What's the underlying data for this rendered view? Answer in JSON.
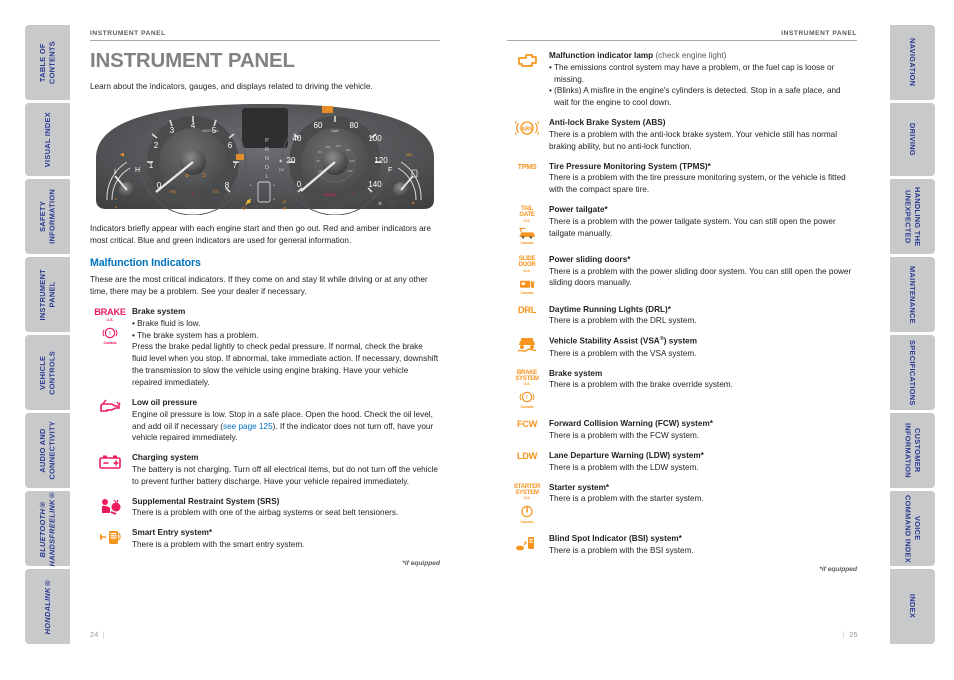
{
  "colors": {
    "red": "#ed1a5b",
    "amber": "#f7941e",
    "blue_heading": "#0071bc",
    "tab_bg": "#c8c9cb",
    "tab_text": "#2b3990",
    "title_gray": "#808285"
  },
  "left_tabs": [
    {
      "label": "TABLE OF\nCONTENTS",
      "italic": false
    },
    {
      "label": "VISUAL INDEX",
      "italic": false
    },
    {
      "label": "SAFETY\nINFORMATION",
      "italic": false
    },
    {
      "label": "INSTRUMENT\nPANEL",
      "italic": false
    },
    {
      "label": "VEHICLE\nCONTROLS",
      "italic": false
    },
    {
      "label": "AUDIO AND\nCONNECTIVITY",
      "italic": false
    },
    {
      "label": "BLUETOOTH®\nHANDSFREELINK®",
      "italic": true
    },
    {
      "label": "HONDALINK®",
      "italic": true
    }
  ],
  "right_tabs": [
    {
      "label": "NAVIGATION"
    },
    {
      "label": "DRIVING"
    },
    {
      "label": "HANDLING THE\nUNEXPECTED"
    },
    {
      "label": "MAINTENANCE"
    },
    {
      "label": "SPECIFICATIONS"
    },
    {
      "label": "CUSTOMER\nINFORMATION"
    },
    {
      "label": "VOICE\nCOMMAND INDEX"
    },
    {
      "label": "INDEX"
    }
  ],
  "left_page": {
    "running_head": "INSTRUMENT PANEL",
    "title": "INSTRUMENT PANEL",
    "lead": "Learn about the indicators, gauges, and displays related to driving the vehicle.",
    "intro": "Indicators briefly appear with each engine start and then go out. Red and amber indicators are most critical. Blue and green indicators are used for general information.",
    "section_heading": "Malfunction Indicators",
    "section_intro": "These are the most critical indicators. If they come on and stay lit while driving or at any other time, there may be a problem. See your dealer if necessary.",
    "footnote": "*if equipped",
    "folio": "24"
  },
  "right_page": {
    "running_head": "INSTRUMENT PANEL",
    "footnote": "*if equipped",
    "folio": "25"
  },
  "left_indicators": [
    {
      "icon": "brake-system-icon",
      "icon_word": "BRAKE",
      "icon_caption_us": "U.S.",
      "icon_caption_ca": "Canada",
      "name": "Brake system",
      "bullets": [
        "• Brake fluid is low.",
        "• The brake system has a problem."
      ],
      "desc": "Press the brake pedal lightly to check pedal pressure. If normal, check the brake fluid level when you stop. If abnormal, take immediate action. If necessary, downshift the transmission to slow the vehicle using engine braking. Have your vehicle repaired immediately."
    },
    {
      "icon": "low-oil-pressure-icon",
      "name": "Low oil pressure",
      "desc_pre": "Engine oil pressure is low. Stop in a safe place. Open the hood. Check the oil level, and add oil if necessary (",
      "desc_link": "see page 125",
      "desc_post": "). If the indicator does not turn off, have your vehicle repaired immediately."
    },
    {
      "icon": "charging-system-icon",
      "name": "Charging system",
      "desc": "The battery is not charging. Turn off all electrical items, but do not turn off the vehicle to prevent further battery discharge. Have your vehicle repaired immediately."
    },
    {
      "icon": "srs-airbag-icon",
      "name": "Supplemental Restraint System (SRS)",
      "desc": "There is a problem with one of the airbag systems or seat belt tensioners."
    },
    {
      "icon": "smart-entry-icon",
      "name": "Smart Entry system*",
      "desc": "There is a problem with the smart entry system."
    }
  ],
  "right_indicators": [
    {
      "icon": "check-engine-icon",
      "name": "Malfunction indicator lamp",
      "name_suffix": " (check engine light)",
      "bullets": [
        "• The emissions control system may have a problem, or the fuel cap is loose or missing.",
        "• (Blinks) A misfire in the engine's cylinders is detected. Stop in a safe place, and wait for the engine to cool down."
      ]
    },
    {
      "icon": "abs-icon",
      "name": "Anti-lock Brake System (ABS)",
      "desc": "There is a problem with the anti-lock brake system. Your vehicle still has normal braking ability, but no anti-lock function."
    },
    {
      "icon": "tpms-icon",
      "icon_word": "TPMS",
      "name": "Tire Pressure Monitoring System (TPMS)*",
      "desc": "There is a problem with the tire pressure monitoring system, or the vehicle is fitted with the compact spare tire."
    },
    {
      "icon": "power-tailgate-icon",
      "icon_word": "TAIL\nGATE",
      "icon_caption_us": "U.S.",
      "icon_caption_ca": "Canada",
      "name": "Power tailgate*",
      "desc": "There is a problem with the power tailgate system. You can still open the power tailgate manually."
    },
    {
      "icon": "power-sliding-doors-icon",
      "icon_word": "SLIDE\nDOOR",
      "icon_caption_us": "U.S.",
      "icon_caption_ca": "Canada",
      "name": "Power sliding doors*",
      "desc": "There is a problem with the power sliding door system. You can still open the power sliding doors manually."
    },
    {
      "icon": "drl-icon",
      "icon_word": "DRL",
      "name": "Daytime Running Lights (DRL)*",
      "desc": "There is a problem with the DRL system."
    },
    {
      "icon": "vsa-icon",
      "name": "Vehicle Stability Assist (VSA",
      "name_sup": "®",
      "name_suffix": ") system",
      "desc": "There is a problem with the VSA system."
    },
    {
      "icon": "brake-system-override-icon",
      "icon_word": "BRAKE\nSYSTEM",
      "icon_caption_us": "U.S.",
      "icon_caption_ca": "Canada",
      "name": "Brake system",
      "desc": "There is a problem with the brake override system."
    },
    {
      "icon": "fcw-icon",
      "icon_word": "FCW",
      "name": "Forward Collision Warning (FCW) system*",
      "desc": "There is a problem with the FCW system."
    },
    {
      "icon": "ldw-icon",
      "icon_word": "LDW",
      "name": "Lane Departure Warning (LDW) system*",
      "desc": "There is a problem with the LDW system."
    },
    {
      "icon": "starter-system-icon",
      "icon_word": "STARTER\nSYSTEM",
      "icon_caption_us": "U.S.",
      "icon_caption_ca": "Canada",
      "name": "Starter system*",
      "desc": "There is a problem with the starter system."
    },
    {
      "icon": "bsi-icon",
      "name": "Blind Spot Indicator (BSI) system*",
      "desc": "There is a problem with the BSI system."
    }
  ],
  "cluster": {
    "alt": "instrument-cluster-illustration",
    "tach_labels": [
      "0",
      "1",
      "2",
      "3",
      "4",
      "5",
      "6",
      "7",
      "8"
    ],
    "tach_unit": "x1000 r/min",
    "speedo_labels": [
      "0",
      "20",
      "40",
      "60",
      "80",
      "100",
      "120",
      "140"
    ],
    "speedo_unit": "mph",
    "gear_positions": [
      "P",
      "R",
      "N",
      "D",
      "D4",
      "L"
    ],
    "temp_label": "H",
    "fuel_label": "F"
  }
}
